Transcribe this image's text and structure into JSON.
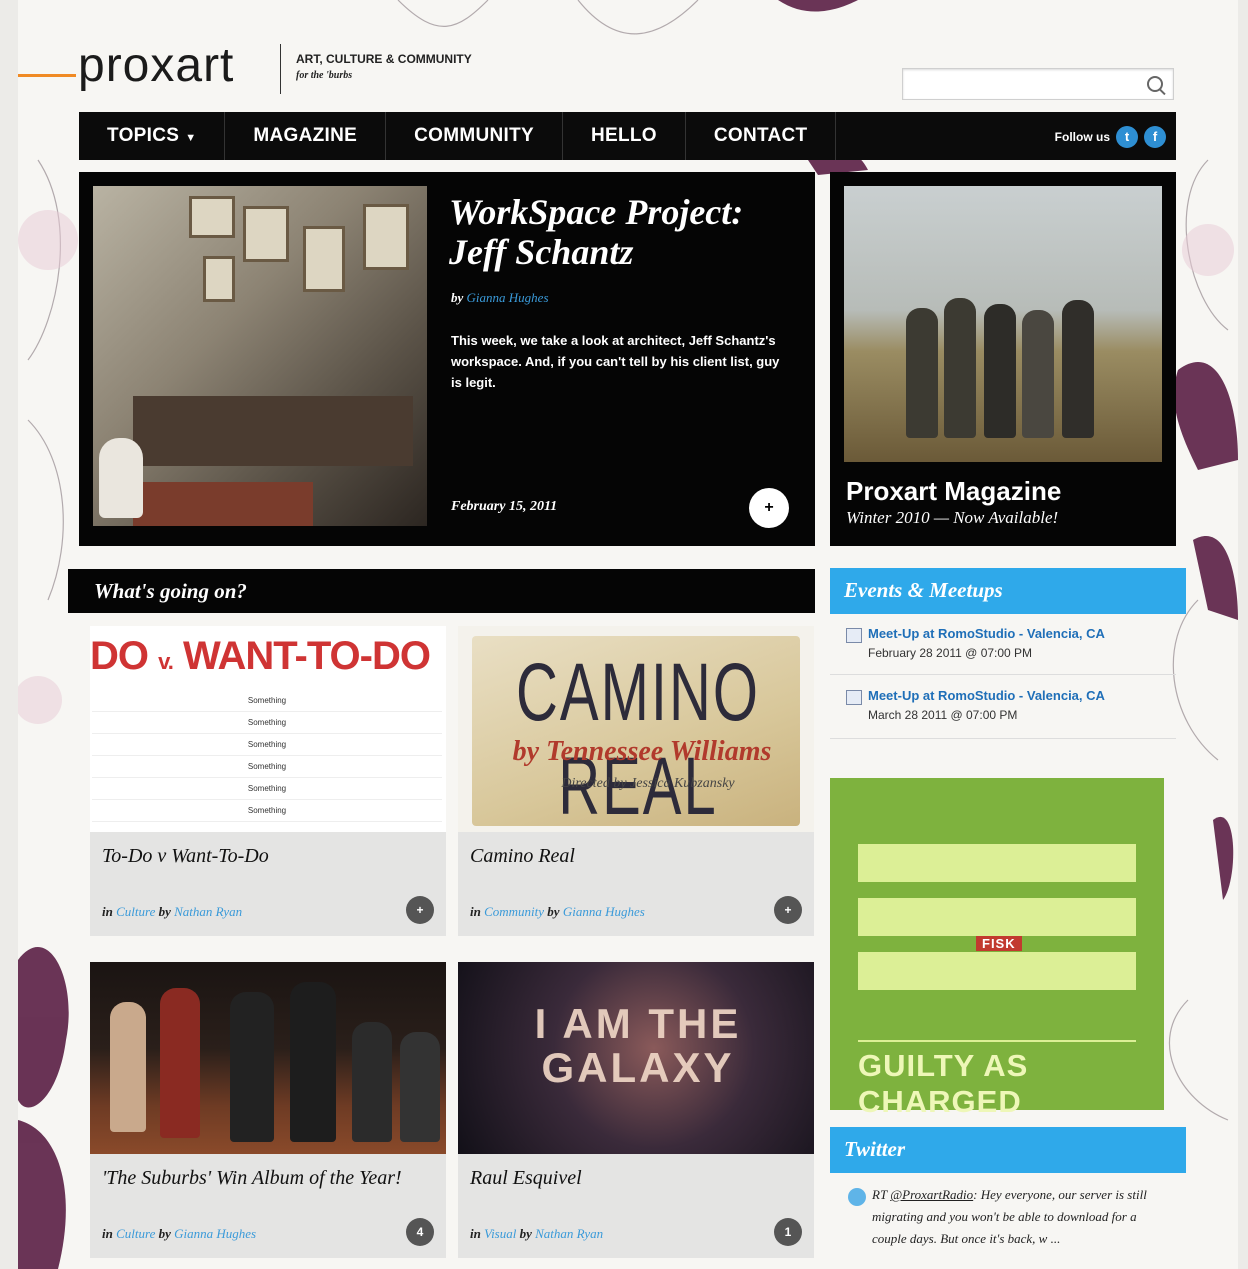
{
  "header": {
    "logo": "proxart",
    "tagline": "ART, CULTURE & COMMUNITY",
    "tagline_sub": "for the 'burbs",
    "search_placeholder": ""
  },
  "nav": {
    "items": [
      "TOPICS",
      "MAGAZINE",
      "COMMUNITY",
      "HELLO",
      "CONTACT"
    ],
    "follow_label": "Follow us"
  },
  "feature": {
    "title": "WorkSpace Project: Jeff Schantz",
    "by_label": "by",
    "author": "Gianna Hughes",
    "description": "This week, we take a look at architect, Jeff Schantz's workspace. And, if you can't tell by his client list, guy is legit.",
    "date": "February 15, 2011",
    "comment_glyph": "+"
  },
  "magazine": {
    "title": "Proxart Magazine",
    "subtitle": "Winter 2010 — Now Available!"
  },
  "whats_going_on": {
    "heading": "What's going on?",
    "cards": [
      {
        "title": "To-Do v Want-To-Do",
        "in_label": "in",
        "category": "Culture",
        "by_label": "by",
        "author": "Nathan Ryan",
        "comments": "+",
        "art_headline_do": "DO",
        "art_headline_v": "v.",
        "art_headline_want": "WANT-TO-DO",
        "art_rows": [
          "Something",
          "Something",
          "Something",
          "Something",
          "Something",
          "Something"
        ]
      },
      {
        "title": "Camino Real",
        "in_label": "in",
        "category": "Community",
        "by_label": "by",
        "author": "Gianna Hughes",
        "comments": "+",
        "art_headline": "CAMINO REAL",
        "art_subtitle": "by Tennessee Williams",
        "art_credit": "Directed by Jessica Kubzansky"
      },
      {
        "title": "'The Suburbs' Win Album of the Year!",
        "in_label": "in",
        "category": "Culture",
        "by_label": "by",
        "author": "Gianna Hughes",
        "comments": "4"
      },
      {
        "title": "Raul Esquivel",
        "in_label": "in",
        "category": "Visual",
        "by_label": "by",
        "author": "Nathan Ryan",
        "comments": "1",
        "art_text": "I AM THE GALAXY"
      }
    ]
  },
  "events": {
    "heading": "Events & Meetups",
    "items": [
      {
        "title": "Meet-Up at RomoStudio - Valencia, CA",
        "date": "February 28 2011 @ 07:00 PM"
      },
      {
        "title": "Meet-Up at RomoStudio - Valencia, CA",
        "date": "March 28 2011 @ 07:00 PM"
      }
    ]
  },
  "ad": {
    "label": "FISK",
    "text": "GUILTY AS CHARGED"
  },
  "twitter": {
    "heading": "Twitter",
    "tweet_prefix": "RT",
    "tweet_handle": "@ProxartRadio",
    "tweet_text": ": Hey everyone, our server is still migrating and you won't be able to download for a couple days. But once it's back, w ..."
  },
  "colors": {
    "accent_blue": "#2fa9ea",
    "link_blue": "#3a9ad9",
    "nav_black": "#0b0b0b",
    "ad_green": "#7eb23e",
    "orange": "#f08a24"
  }
}
